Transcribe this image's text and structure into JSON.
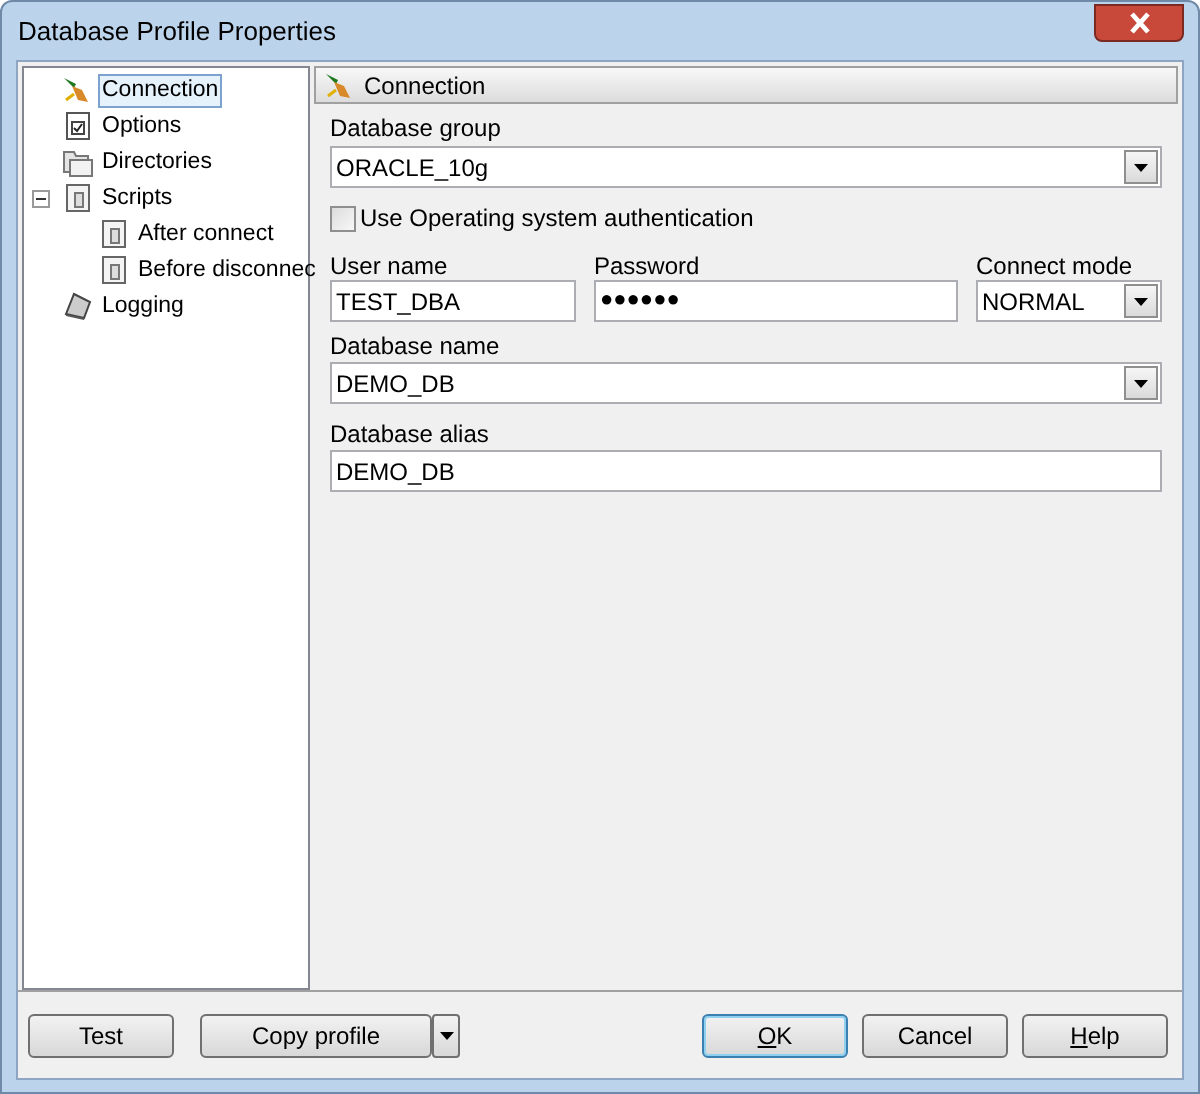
{
  "window": {
    "title": "Database Profile Properties"
  },
  "tree": [
    {
      "label": "Connection",
      "kind": "plug",
      "selected": true
    },
    {
      "label": "Options",
      "kind": "checklist",
      "selected": false
    },
    {
      "label": "Directories",
      "kind": "folders",
      "selected": false
    },
    {
      "label": "Scripts",
      "kind": "script",
      "selected": false,
      "expanded": true,
      "children": [
        {
          "label": "After connect",
          "kind": "script",
          "selected": false
        },
        {
          "label": "Before disconnec",
          "kind": "script",
          "selected": false
        }
      ]
    },
    {
      "label": "Logging",
      "kind": "log",
      "selected": false
    }
  ],
  "section_header": "Connection",
  "database_group": {
    "label": "Database group",
    "value": "ORACLE_10g"
  },
  "os_auth": {
    "label": "Use Operating system authentication",
    "checked": false
  },
  "user_name": {
    "label": "User name",
    "value": "TEST_DBA"
  },
  "password": {
    "label": "Password",
    "value": "●●●●●●"
  },
  "connect_mode": {
    "label": "Connect mode",
    "value": "NORMAL"
  },
  "database_name": {
    "label": "Database name",
    "value": "DEMO_DB"
  },
  "database_alias": {
    "label": "Database alias",
    "value": "DEMO_DB"
  },
  "buttons": [
    {
      "label": "Test",
      "kind": "plain",
      "underline_first": false
    },
    {
      "label": "Copy profile",
      "kind": "split",
      "underline_first": false
    },
    {
      "label": "OK",
      "kind": "default",
      "underline_first": true
    },
    {
      "label": "Cancel",
      "kind": "plain",
      "underline_first": false
    },
    {
      "label": "Help",
      "kind": "plain",
      "underline_first": true
    }
  ]
}
